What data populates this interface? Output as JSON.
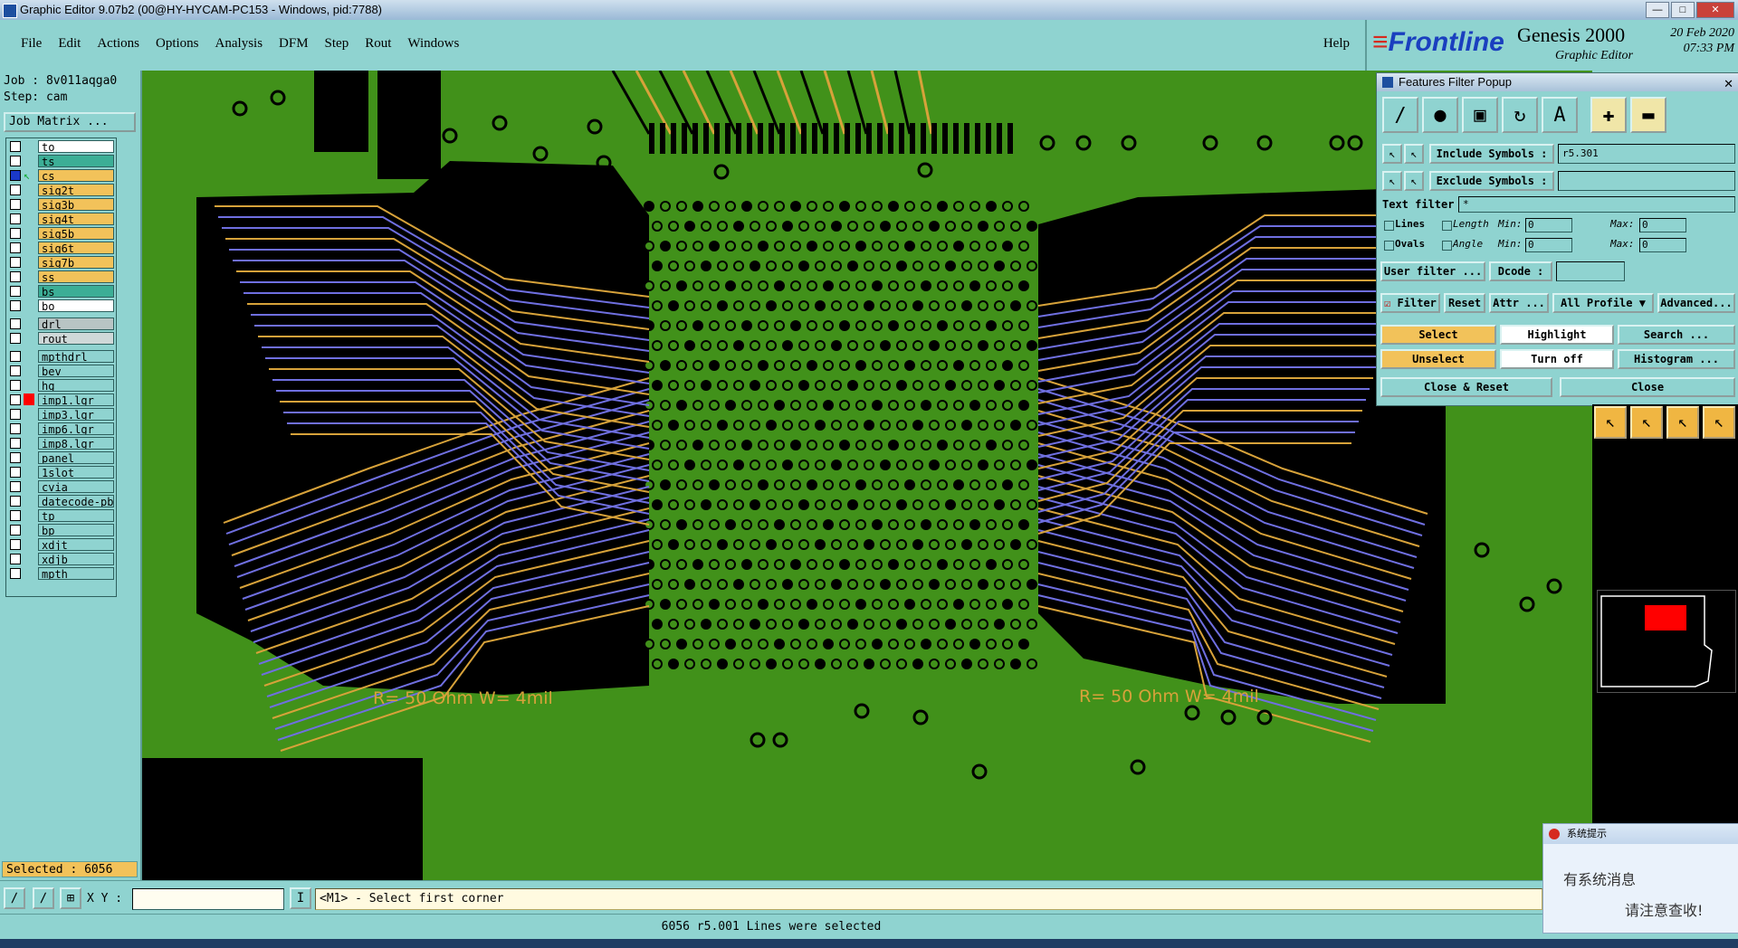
{
  "window": {
    "title": "Graphic Editor 9.07b2 (00@HY-HYCAM-PC153 - Windows, pid:7788)"
  },
  "menu": {
    "items": [
      "File",
      "Edit",
      "Actions",
      "Options",
      "Analysis",
      "DFM",
      "Step",
      "Rout",
      "Windows"
    ],
    "help": "Help"
  },
  "brand": {
    "logo": "Frontline",
    "product": "Genesis 2000",
    "subtitle": "Graphic Editor",
    "date": "20 Feb 2020",
    "time": "07:33 PM"
  },
  "job": {
    "job_line": "Job : 8v011aqga0",
    "step_line": "Step: cam",
    "matrix_button": "Job Matrix ..."
  },
  "layers": [
    {
      "name": "to",
      "color": "#ffffff",
      "checked": false
    },
    {
      "name": "ts",
      "color": "#3cae96",
      "checked": false
    },
    {
      "name": "cs",
      "color": "#f2c25a",
      "checked": true
    },
    {
      "name": "sig2t",
      "color": "#f2c25a",
      "checked": false
    },
    {
      "name": "sig3b",
      "color": "#f2c25a",
      "checked": false
    },
    {
      "name": "sig4t",
      "color": "#f2c25a",
      "checked": false
    },
    {
      "name": "sig5b",
      "color": "#f2c25a",
      "checked": false
    },
    {
      "name": "sig6t",
      "color": "#f2c25a",
      "checked": false
    },
    {
      "name": "sig7b",
      "color": "#f2c25a",
      "checked": false
    },
    {
      "name": "ss",
      "color": "#f2c25a",
      "checked": false
    },
    {
      "name": "bs",
      "color": "#3cae96",
      "checked": false
    },
    {
      "name": "bo",
      "color": "#ffffff",
      "checked": false
    },
    {
      "name": "drl",
      "color": "#b8c4c4",
      "checked": false
    },
    {
      "name": "rout",
      "color": "#cfd8d8",
      "checked": false
    },
    {
      "name": "mpthdrl",
      "color": "#8fd3d0",
      "checked": false
    },
    {
      "name": "bev",
      "color": "#8fd3d0",
      "checked": false
    },
    {
      "name": "hg",
      "color": "#8fd3d0",
      "checked": false
    },
    {
      "name": "imp1.lgr",
      "color": "#8fd3d0",
      "checked": false
    },
    {
      "name": "imp3.lgr",
      "color": "#8fd3d0",
      "checked": false
    },
    {
      "name": "imp6.lgr",
      "color": "#8fd3d0",
      "checked": false
    },
    {
      "name": "imp8.lgr",
      "color": "#8fd3d0",
      "checked": false
    },
    {
      "name": "panel",
      "color": "#8fd3d0",
      "checked": false
    },
    {
      "name": "1slot",
      "color": "#8fd3d0",
      "checked": false
    },
    {
      "name": "cvia",
      "color": "#8fd3d0",
      "checked": false
    },
    {
      "name": "datecode-pbo",
      "color": "#8fd3d0",
      "checked": false
    },
    {
      "name": "tp",
      "color": "#8fd3d0",
      "checked": false
    },
    {
      "name": "bp",
      "color": "#8fd3d0",
      "checked": false
    },
    {
      "name": "xdjt",
      "color": "#8fd3d0",
      "checked": false
    },
    {
      "name": "xdjb",
      "color": "#8fd3d0",
      "checked": false
    },
    {
      "name": "mpth",
      "color": "#8fd3d0",
      "checked": false
    }
  ],
  "selected_text": "Selected : 6056",
  "canvas": {
    "board_color": "#41911a",
    "trace_blue": "#6f6fe0",
    "trace_orange": "#d7a23a",
    "label_left": "R= 50 Ohm W= 4mil",
    "label_right": "R= 50 Ohm W= 4mil"
  },
  "filter_popup": {
    "title": "Features Filter Popup",
    "include_label": "Include Symbols :",
    "include_value": "r5.301",
    "exclude_label": "Exclude Symbols :",
    "exclude_value": "",
    "text_filter_label": "Text filter",
    "text_filter_value": "*",
    "lines_label": "Lines",
    "ovals_label": "Ovals",
    "length_label": "Length",
    "angle_label": "Angle",
    "min_label": "Min:",
    "max_label": "Max:",
    "length_min": "0",
    "length_max": "0",
    "angle_min": "0",
    "angle_max": "0",
    "user_filter": "User filter ...",
    "dcode_label": "Dcode :",
    "dcode_value": "",
    "filter_btn": "Filter",
    "reset_btn": "Reset",
    "attr_btn": "Attr ...",
    "profile_btn": "All Profile",
    "advanced_btn": "Advanced...",
    "select_btn": "Select",
    "highlight_btn": "Highlight",
    "search_btn": "Search ...",
    "unselect_btn": "Unselect",
    "turnoff_btn": "Turn off",
    "histogram_btn": "Histogram ...",
    "close_reset_btn": "Close & Reset",
    "close_btn": "Close"
  },
  "prompt": {
    "xy_label": "X Y :",
    "xy_value": "",
    "message": "<M1> - Select first corner"
  },
  "status": "6056 r5.001 Lines were selected",
  "notification": {
    "header": "系统提示",
    "line1": "有系统消息",
    "line2": "请注意查收!"
  }
}
